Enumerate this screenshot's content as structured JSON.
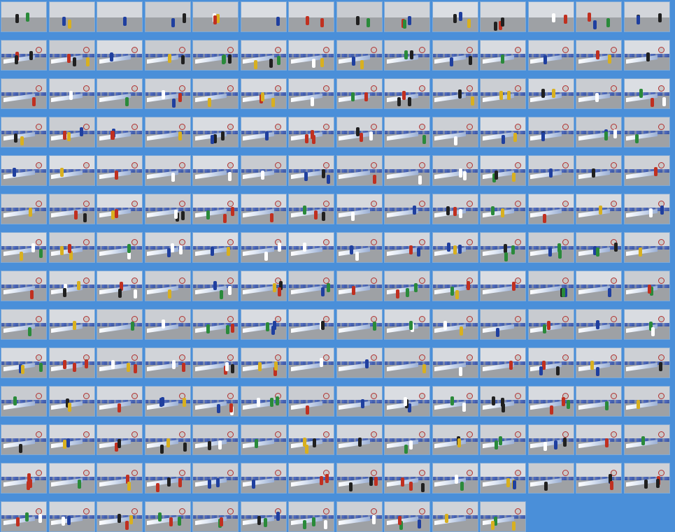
{
  "gallery": {
    "rows": [
      {
        "cols": [
          0,
          1,
          2,
          3,
          4,
          5,
          6,
          7,
          8,
          9,
          10,
          11,
          12,
          13
        ]
      },
      {
        "cols": [
          0,
          1,
          2,
          3,
          4,
          5,
          6,
          7,
          8,
          9,
          10,
          11,
          12,
          13
        ]
      },
      {
        "cols": [
          0,
          1,
          2,
          3,
          4,
          5,
          6,
          7,
          8,
          9,
          10,
          11,
          12,
          13
        ]
      },
      {
        "cols": [
          0,
          1,
          2,
          3,
          4,
          5,
          6,
          7,
          8,
          9,
          10,
          11,
          12,
          13
        ]
      },
      {
        "cols": [
          0,
          1,
          2,
          3,
          4,
          5,
          6,
          7,
          8,
          9,
          10,
          11,
          12,
          13
        ]
      },
      {
        "cols": [
          0,
          1,
          2,
          3,
          4,
          5,
          6,
          7,
          8,
          9,
          10,
          11,
          12,
          13
        ]
      },
      {
        "cols": [
          0,
          1,
          2,
          3,
          4,
          5,
          6,
          7,
          8,
          9,
          10,
          11,
          12,
          13
        ]
      },
      {
        "cols": [
          0,
          1,
          2,
          3,
          4,
          5,
          6,
          7,
          8,
          9,
          10,
          11,
          12,
          13
        ]
      },
      {
        "cols": [
          0,
          1,
          2,
          3,
          4,
          5,
          6,
          7,
          8,
          9,
          10,
          11,
          12,
          13
        ]
      },
      {
        "cols": [
          0,
          1,
          2,
          3,
          4,
          5,
          6,
          7,
          8,
          9,
          10,
          11,
          12,
          13
        ]
      },
      {
        "cols": [
          0,
          1,
          2,
          3,
          4,
          5,
          6,
          7,
          8,
          9,
          10,
          11,
          12,
          13
        ]
      },
      {
        "cols": [
          0,
          1,
          2,
          3,
          4,
          5,
          6,
          7,
          8,
          9,
          10,
          11,
          12,
          13
        ]
      },
      {
        "cols": [
          0,
          1,
          2,
          3,
          4,
          5,
          6,
          7,
          8,
          9,
          10,
          11,
          12,
          13
        ]
      },
      {
        "cols": [
          0,
          1,
          2,
          3,
          4,
          5,
          6,
          7,
          8,
          9,
          10
        ]
      }
    ],
    "colors": {
      "background": "#4a8fd9",
      "fog": "#cfd3d8",
      "road": "#9ea1a5",
      "runner_colors": [
        "#c03020",
        "#1f3f9f",
        "#202020",
        "#d8b020",
        "#ffffff",
        "#2a8a3a"
      ]
    }
  }
}
